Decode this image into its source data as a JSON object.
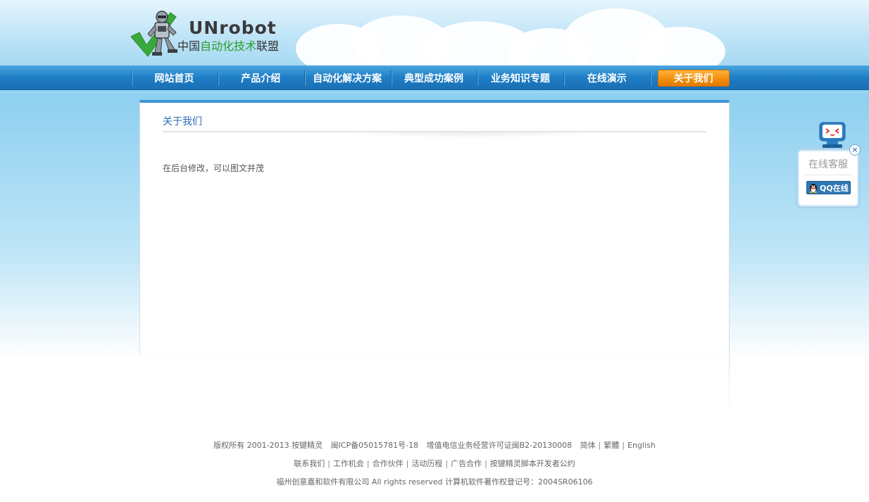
{
  "logo": {
    "title": "UNrobot",
    "sub_prefix": "中国",
    "sub_highlight": "自动化技术",
    "sub_suffix": "联盟"
  },
  "nav": {
    "items": [
      {
        "label": "网站首页"
      },
      {
        "label": "产品介绍"
      },
      {
        "label": "自动化解决方案"
      },
      {
        "label": "典型成功案例"
      },
      {
        "label": "业务知识专题"
      },
      {
        "label": "在线演示"
      },
      {
        "label": "关于我们"
      }
    ],
    "active_index": 6
  },
  "content": {
    "title": "关于我们",
    "body": "在后台修改，可以图文并茂"
  },
  "customer_service": {
    "title": "在线客服",
    "qq_label": "QQ在线",
    "close_symbol": "×"
  },
  "footer": {
    "copyright": "版权所有 2001-2013 按键精灵",
    "icp": "闽ICP备05015781号-18",
    "license": "增值电信业务经营许可证闽B2-20130008",
    "lang_simplified": "简体",
    "lang_traditional": "繁體",
    "lang_english": "English",
    "links": [
      "联系我们",
      "工作机会",
      "合作伙伴",
      "活动历程",
      "广告合作",
      "按键精灵脚本开发者公约"
    ],
    "company": "福州创意嘉和软件有限公司 All rights reserved 计算机软件著作权登记号：2004SR06106"
  },
  "colors": {
    "nav_blue": "#1e7ec6",
    "active_orange": "#f18c07",
    "title_blue": "#2b6cb3",
    "panel_border_top": "#3d95d6"
  }
}
